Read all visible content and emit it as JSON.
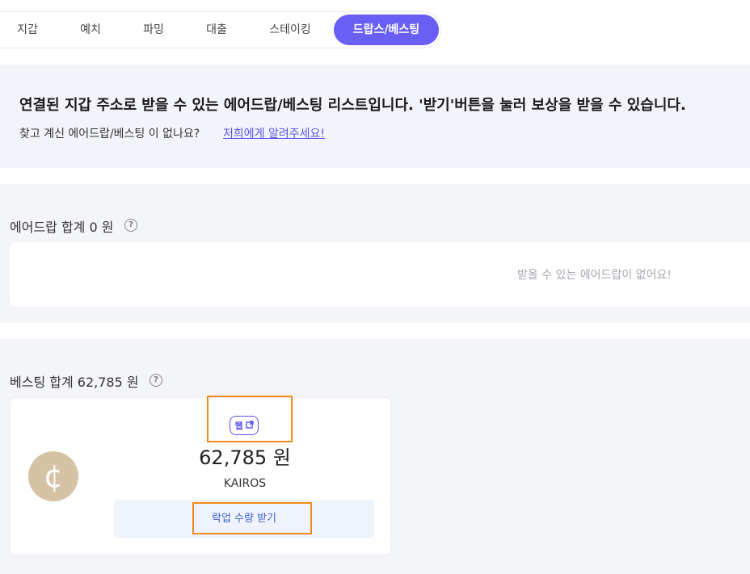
{
  "tabs": [
    {
      "label": "지갑"
    },
    {
      "label": "예치"
    },
    {
      "label": "파밍"
    },
    {
      "label": "대출"
    },
    {
      "label": "스테이킹"
    },
    {
      "label": "드랍스/베스팅",
      "active": true
    }
  ],
  "banner": {
    "title": "연결된 지갑 주소로 받을 수 있는 에어드랍/베스팅 리스트입니다. '받기'버튼을 눌러 보상을 받을 수 있습니다.",
    "subtitle": "찾고 계신 에어드랍/베스팅 이 없나요?",
    "link": "저희에게 알려주세요!"
  },
  "airdrop": {
    "title": "에어드랍 합계 0 원",
    "empty_text": "받을 수 있는 에어드랍이 없어요!"
  },
  "vesting": {
    "title": "베스팅 합계 62,785 원",
    "card": {
      "badge": "웹",
      "amount": "62,785 원",
      "token": "KAIROS",
      "claim_label": "락업 수량 받기",
      "coin_icon": "cent-coin-icon"
    }
  },
  "colors": {
    "accent": "#6a5ff5",
    "link": "#5a55e8",
    "highlight": "#f28a1a",
    "coin": "#d6c3a6"
  }
}
